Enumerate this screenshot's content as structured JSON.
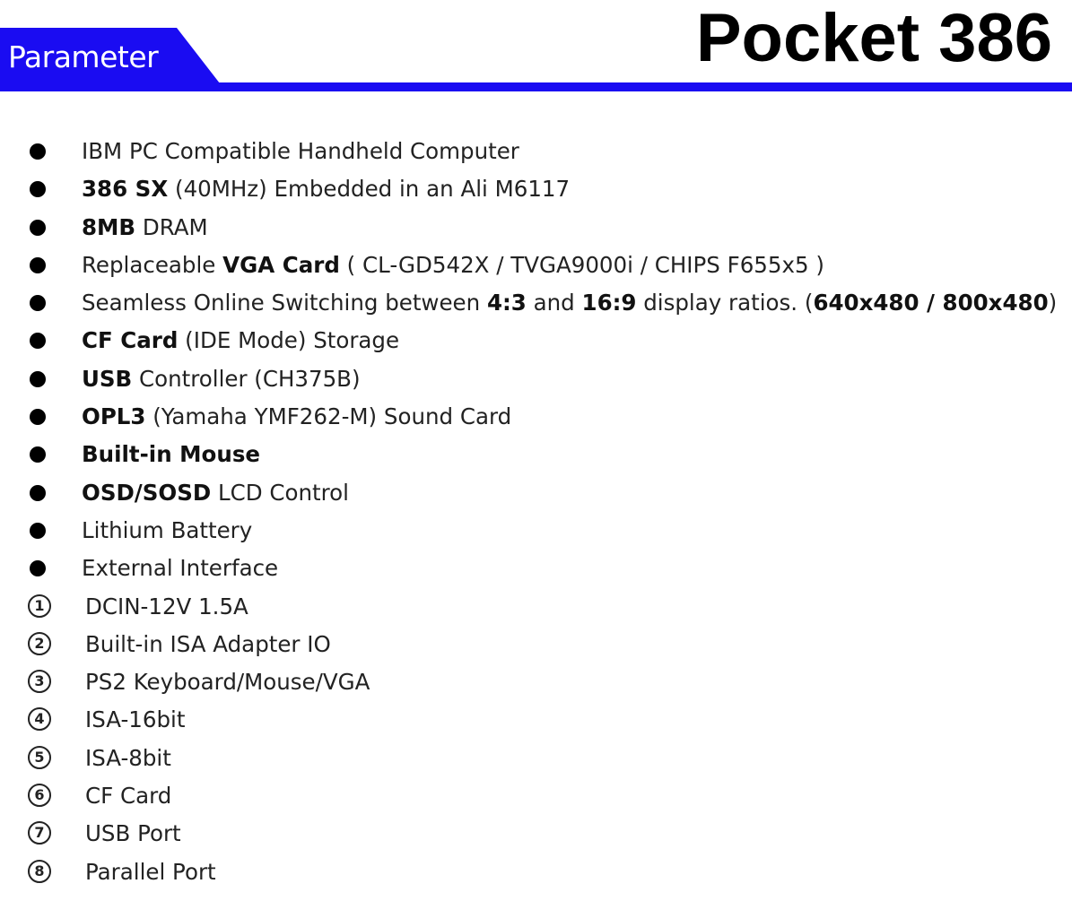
{
  "header": {
    "tab_label": "Parameter",
    "title": "Pocket 386",
    "accent_color": "#1a0cf2"
  },
  "specs": [
    {
      "parts": [
        {
          "t": "IBM PC Compatible Handheld Computer",
          "b": false
        }
      ]
    },
    {
      "parts": [
        {
          "t": "386 SX",
          "b": true
        },
        {
          "t": " (40MHz) Embedded in an Ali M6117",
          "b": false
        }
      ]
    },
    {
      "parts": [
        {
          "t": "8MB",
          "b": true
        },
        {
          "t": " DRAM",
          "b": false
        }
      ]
    },
    {
      "parts": [
        {
          "t": "Replaceable ",
          "b": false
        },
        {
          "t": "VGA Card",
          "b": true
        },
        {
          "t": " ( CL-GD542X / TVGA9000i / CHIPS F655x5 )",
          "b": false
        }
      ]
    },
    {
      "parts": [
        {
          "t": "Seamless Online Switching between ",
          "b": false
        },
        {
          "t": "4:3",
          "b": true
        },
        {
          "t": " and ",
          "b": false
        },
        {
          "t": "16:9",
          "b": true
        },
        {
          "t": " display ratios. (",
          "b": false
        },
        {
          "t": "640x480 / 800x480",
          "b": true
        },
        {
          "t": ")",
          "b": false
        }
      ]
    },
    {
      "parts": [
        {
          "t": "CF Card",
          "b": true
        },
        {
          "t": " (IDE Mode) Storage",
          "b": false
        }
      ]
    },
    {
      "parts": [
        {
          "t": "USB",
          "b": true
        },
        {
          "t": " Controller (CH375B)",
          "b": false
        }
      ]
    },
    {
      "parts": [
        {
          "t": "OPL3",
          "b": true
        },
        {
          "t": " (Yamaha YMF262-M) Sound Card",
          "b": false
        }
      ]
    },
    {
      "parts": [
        {
          "t": "Built-in Mouse",
          "b": true
        }
      ]
    },
    {
      "parts": [
        {
          "t": "OSD/SOSD",
          "b": true
        },
        {
          "t": " LCD Control",
          "b": false
        }
      ]
    },
    {
      "parts": [
        {
          "t": "Lithium Battery",
          "b": false
        }
      ]
    },
    {
      "parts": [
        {
          "t": "External Interface",
          "b": false
        }
      ]
    }
  ],
  "interfaces": [
    {
      "num": "1",
      "label": "DCIN-12V 1.5A"
    },
    {
      "num": "2",
      "label": "Built-in ISA Adapter IO"
    },
    {
      "num": "3",
      "label": "PS2 Keyboard/Mouse/VGA"
    },
    {
      "num": "4",
      "label": "ISA-16bit"
    },
    {
      "num": "5",
      "label": "ISA-8bit"
    },
    {
      "num": "6",
      "label": "CF Card"
    },
    {
      "num": "7",
      "label": "USB Port"
    },
    {
      "num": "8",
      "label": "Parallel Port"
    }
  ]
}
